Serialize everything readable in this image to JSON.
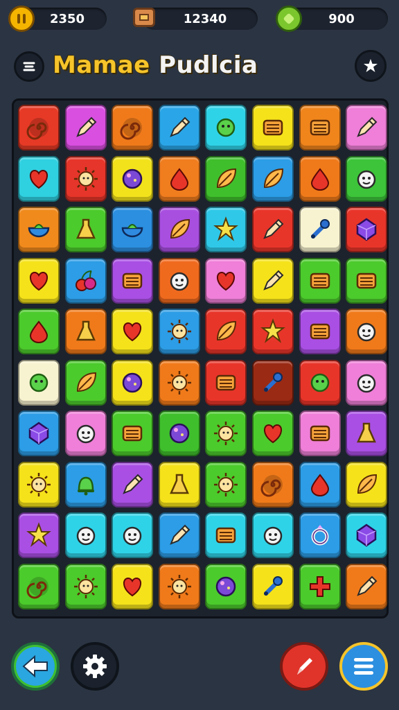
{
  "hud": {
    "coins": "2350",
    "chest": "12340",
    "gems": "900"
  },
  "header": {
    "title_word1": "Mamae",
    "title_word2": "Pudlcia"
  },
  "board": {
    "rows": [
      [
        {
          "c": "#e63a26",
          "i": "spiral"
        },
        {
          "c": "#d94fe0",
          "i": "pencil"
        },
        {
          "c": "#f07a1a",
          "i": "spiral"
        },
        {
          "c": "#2aa6e8",
          "i": "pencil"
        },
        {
          "c": "#2fd3e8",
          "i": "blob"
        },
        {
          "c": "#f5e21a",
          "i": "box"
        },
        {
          "c": "#f0851c",
          "i": "box"
        },
        {
          "c": "#ef7fd8",
          "i": "pencil"
        }
      ],
      [
        {
          "c": "#2fd0e0",
          "i": "heart"
        },
        {
          "c": "#e6352a",
          "i": "sun"
        },
        {
          "c": "#f2e21c",
          "i": "ball"
        },
        {
          "c": "#f07d1e",
          "i": "drop"
        },
        {
          "c": "#3fbf2c",
          "i": "leaf"
        },
        {
          "c": "#2c9de6",
          "i": "leaf"
        },
        {
          "c": "#f07a1a",
          "i": "drop"
        },
        {
          "c": "#3dc43a",
          "i": "face"
        }
      ],
      [
        {
          "c": "#f08a1c",
          "i": "bowl"
        },
        {
          "c": "#4ccb2c",
          "i": "flask"
        },
        {
          "c": "#2c8fe0",
          "i": "bowl"
        },
        {
          "c": "#a84fe0",
          "i": "leaf"
        },
        {
          "c": "#2fc8e8",
          "i": "star"
        },
        {
          "c": "#e8352a",
          "i": "pencil"
        },
        {
          "c": "#f7f3d0",
          "i": "wrench"
        },
        {
          "c": "#e8352a",
          "i": "gem"
        }
      ],
      [
        {
          "c": "#f5e21a",
          "i": "heart"
        },
        {
          "c": "#2c9de6",
          "i": "cherry"
        },
        {
          "c": "#a94fe4",
          "i": "box"
        },
        {
          "c": "#f06a1e",
          "i": "face"
        },
        {
          "c": "#ef7fd8",
          "i": "heart"
        },
        {
          "c": "#f5e21a",
          "i": "pencil"
        },
        {
          "c": "#4ccb2c",
          "i": "box"
        },
        {
          "c": "#4ccb2c",
          "i": "box"
        }
      ],
      [
        {
          "c": "#4ccb2c",
          "i": "drop"
        },
        {
          "c": "#f07a1a",
          "i": "flask"
        },
        {
          "c": "#f5e21a",
          "i": "heart"
        },
        {
          "c": "#2c9de6",
          "i": "sun"
        },
        {
          "c": "#e8352a",
          "i": "leaf"
        },
        {
          "c": "#e8352a",
          "i": "star"
        },
        {
          "c": "#a94fe4",
          "i": "box"
        },
        {
          "c": "#f07a1a",
          "i": "face"
        }
      ],
      [
        {
          "c": "#f7f3d0",
          "i": "blob"
        },
        {
          "c": "#4ccb2c",
          "i": "leaf"
        },
        {
          "c": "#f5e21a",
          "i": "ball"
        },
        {
          "c": "#f07a1a",
          "i": "sun"
        },
        {
          "c": "#e8352a",
          "i": "box"
        },
        {
          "c": "#9a2a14",
          "i": "wrench"
        },
        {
          "c": "#e8352a",
          "i": "blob"
        },
        {
          "c": "#ef7fd8",
          "i": "face"
        }
      ],
      [
        {
          "c": "#2c9de6",
          "i": "gem"
        },
        {
          "c": "#ef7fd8",
          "i": "face"
        },
        {
          "c": "#4ccb2c",
          "i": "box"
        },
        {
          "c": "#3fbf2c",
          "i": "ball"
        },
        {
          "c": "#4ccb2c",
          "i": "sun"
        },
        {
          "c": "#4ccb2c",
          "i": "heart"
        },
        {
          "c": "#ef7fd8",
          "i": "box"
        },
        {
          "c": "#a94fe4",
          "i": "flask"
        }
      ],
      [
        {
          "c": "#f5e21a",
          "i": "sun"
        },
        {
          "c": "#2c9de6",
          "i": "bell"
        },
        {
          "c": "#a94fe4",
          "i": "pencil"
        },
        {
          "c": "#f5e21a",
          "i": "flask"
        },
        {
          "c": "#4ccb2c",
          "i": "sun"
        },
        {
          "c": "#f07a1a",
          "i": "spiral"
        },
        {
          "c": "#2c9de6",
          "i": "drop"
        },
        {
          "c": "#f5e21a",
          "i": "leaf"
        }
      ],
      [
        {
          "c": "#a94fe4",
          "i": "star"
        },
        {
          "c": "#2fd3e8",
          "i": "face"
        },
        {
          "c": "#2fd3e8",
          "i": "face"
        },
        {
          "c": "#2c9de6",
          "i": "pencil"
        },
        {
          "c": "#2fd3e8",
          "i": "box"
        },
        {
          "c": "#2fd3e8",
          "i": "face"
        },
        {
          "c": "#2c9de6",
          "i": "ring"
        },
        {
          "c": "#2fd3e8",
          "i": "gem"
        }
      ],
      [
        {
          "c": "#4ccb2c",
          "i": "spiral"
        },
        {
          "c": "#4ccb2c",
          "i": "sun"
        },
        {
          "c": "#f5e21a",
          "i": "heart"
        },
        {
          "c": "#f07a1a",
          "i": "sun"
        },
        {
          "c": "#4ccb2c",
          "i": "ball"
        },
        {
          "c": "#f5e21a",
          "i": "wrench"
        },
        {
          "c": "#4ccb2c",
          "i": "cross"
        },
        {
          "c": "#f07a1a",
          "i": "pencil"
        }
      ]
    ]
  },
  "colors": {
    "back": "#2aa6e0",
    "share": "#e0342a",
    "menu": "#2c8fe0"
  }
}
